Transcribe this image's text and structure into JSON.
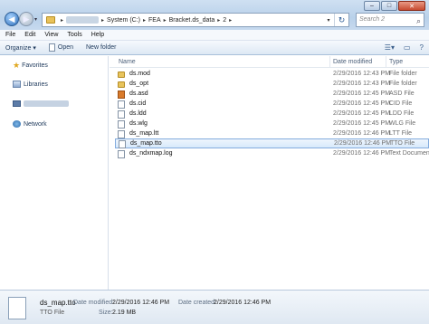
{
  "titlebar": {
    "controls": {
      "minimize": "–",
      "maximize": "□",
      "close": "✕"
    }
  },
  "address": {
    "segments": [
      "System (C:)",
      "FEA",
      "Bracket.ds_data",
      "2"
    ],
    "separator": "▸"
  },
  "search": {
    "placeholder": "Search 2"
  },
  "menu": [
    "File",
    "Edit",
    "View",
    "Tools",
    "Help"
  ],
  "toolbar": {
    "organize": "Organize ▾",
    "open": "Open",
    "new_folder": "New folder"
  },
  "nav": {
    "favorites": "Favorites",
    "libraries": "Libraries",
    "network": "Network"
  },
  "columns": {
    "name": "Name",
    "date": "Date modified",
    "type": "Type"
  },
  "files": [
    {
      "name": "ds.mod",
      "date": "2/29/2016 12:43 PM",
      "type": "File folder",
      "icon": "folder"
    },
    {
      "name": "ds_opt",
      "date": "2/29/2016 12:43 PM",
      "type": "File folder",
      "icon": "folder"
    },
    {
      "name": "ds.asd",
      "date": "2/29/2016 12:45 PM",
      "type": "ASD File",
      "icon": "asd"
    },
    {
      "name": "ds.cid",
      "date": "2/29/2016 12:45 PM",
      "type": "CID File",
      "icon": "doc"
    },
    {
      "name": "ds.ldd",
      "date": "2/29/2016 12:45 PM",
      "type": "LDD File",
      "icon": "doc"
    },
    {
      "name": "ds.wlg",
      "date": "2/29/2016 12:45 PM",
      "type": "WLG File",
      "icon": "doc"
    },
    {
      "name": "ds_map.ltt",
      "date": "2/29/2016 12:46 PM",
      "type": "LTT File",
      "icon": "doc"
    },
    {
      "name": "ds_map.tto",
      "date": "2/29/2016 12:46 PM",
      "type": "TTO File",
      "icon": "doc",
      "selected": true
    },
    {
      "name": "ds_ndxmap.log",
      "date": "2/29/2016 12:46 PM",
      "type": "Text Documen",
      "icon": "doc"
    }
  ],
  "details": {
    "name": "ds_map.tto",
    "type": "TTO File",
    "date_modified_label": "Date modified:",
    "date_modified": "2/29/2016 12:46 PM",
    "date_created_label": "Date created:",
    "date_created": "2/29/2016 12:46 PM",
    "size_label": "Size:",
    "size": "2.19 MB"
  }
}
